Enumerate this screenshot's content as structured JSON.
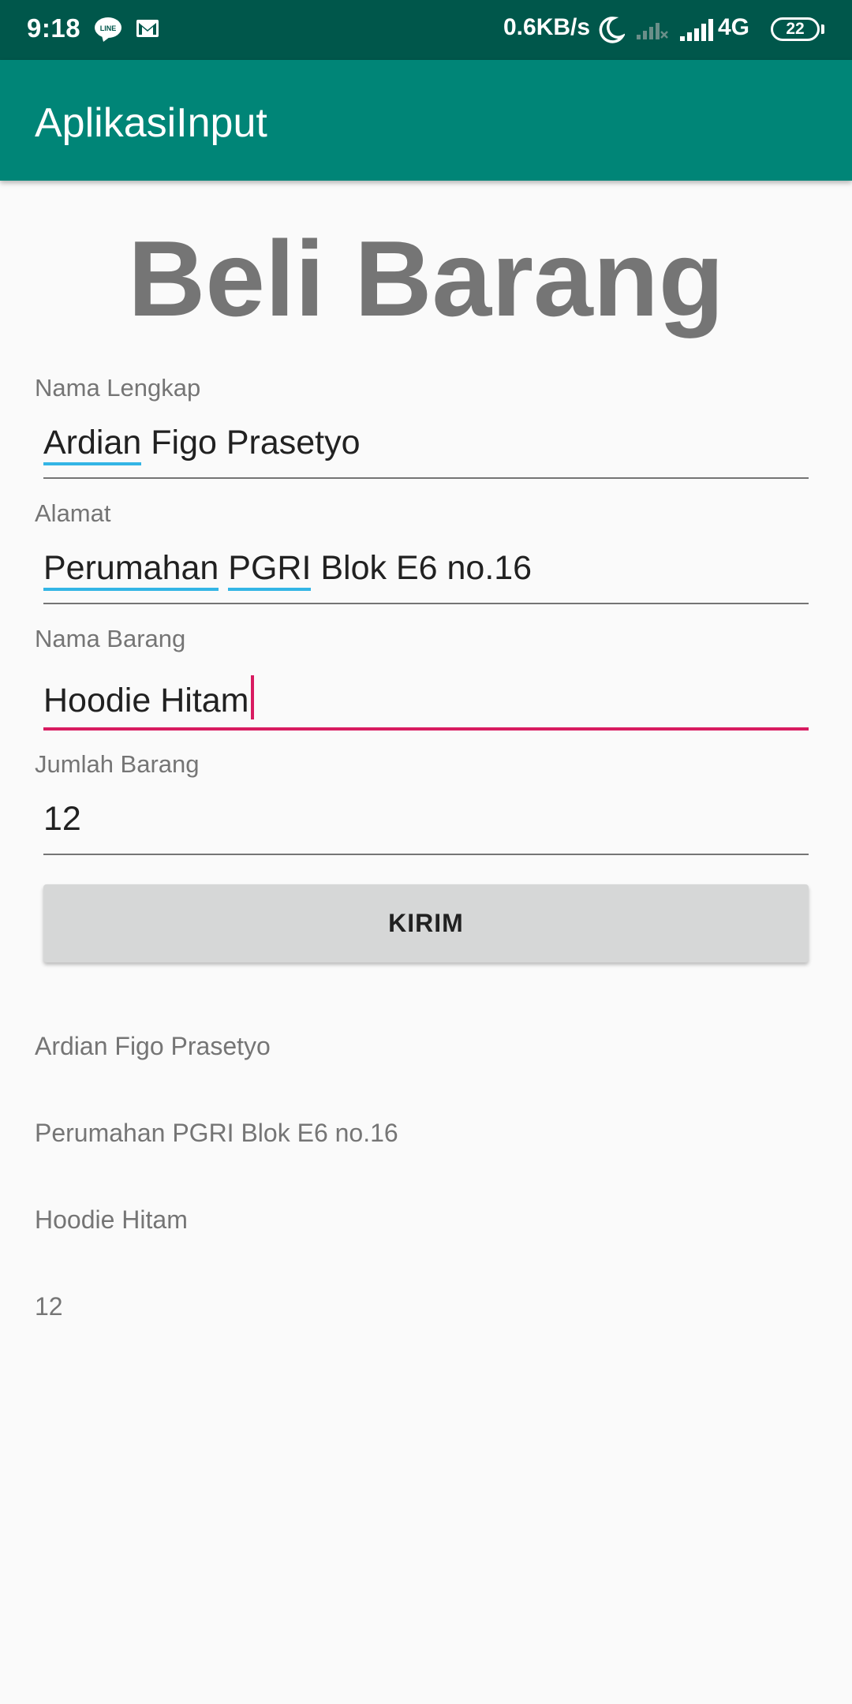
{
  "status_bar": {
    "time": "9:18",
    "speed": "0.6KB/s",
    "network_type": "4G",
    "battery_level": "22",
    "icons": [
      "line-icon",
      "gmail-icon",
      "moon-icon",
      "signal-icon",
      "signal-icon"
    ]
  },
  "app_bar": {
    "title": "AplikasiInput"
  },
  "heading": "Beli Barang",
  "form": {
    "nama_lengkap": {
      "label": "Nama Lengkap",
      "value_part1": "Ardian",
      "value_part2": " Figo Prasetyo"
    },
    "alamat": {
      "label": "Alamat",
      "value_part1": "Perumahan",
      "value_part2": "PGRI",
      "value_part3": " Blok E6 no.16"
    },
    "nama_barang": {
      "label": "Nama Barang",
      "value": "Hoodie Hitam"
    },
    "jumlah_barang": {
      "label": "Jumlah Barang",
      "value": "12"
    },
    "submit_label": "KIRIM"
  },
  "results": {
    "nama": "Ardian Figo Prasetyo",
    "alamat": "Perumahan PGRI Blok E6 no.16",
    "barang": "Hoodie Hitam",
    "jumlah": "12"
  },
  "colors": {
    "status_bar": "#00574b",
    "app_bar": "#008577",
    "accent": "#d81b60",
    "spellcheck": "#33b5e5",
    "background": "#fafafa"
  }
}
